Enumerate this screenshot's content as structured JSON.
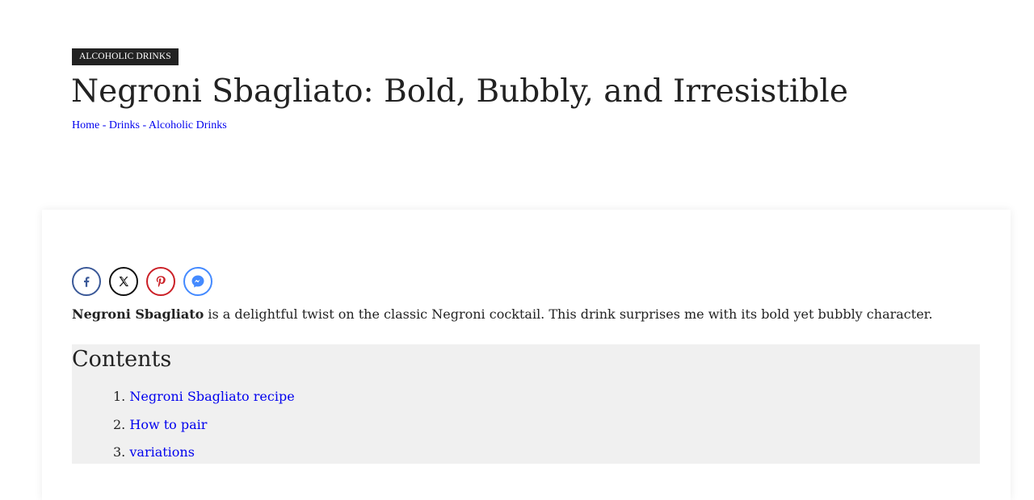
{
  "article": {
    "category": "ALCOHOLIC DRINKS",
    "title": "Negroni Sbagliato: Bold, Bubbly, and Irresistible",
    "breadcrumb": [
      {
        "label": "Home"
      },
      {
        "label": "Drinks"
      },
      {
        "label": "Alcoholic Drinks"
      }
    ],
    "breadcrumb_separator": " - "
  },
  "share": {
    "buttons": [
      {
        "name": "facebook",
        "icon": "facebook-icon",
        "color": "#3b5998"
      },
      {
        "name": "x",
        "icon": "x-icon",
        "color": "#111111"
      },
      {
        "name": "pinterest",
        "icon": "pinterest-icon",
        "color": "#cb2027"
      },
      {
        "name": "messenger",
        "icon": "messenger-icon",
        "color": "#448aff"
      }
    ]
  },
  "intro": {
    "bold": "Negroni Sbagliato",
    "text": " is a delightful twist on the classic Negroni cocktail. This drink surprises me with its bold yet bubbly character."
  },
  "toc": {
    "title": "Contents",
    "items": [
      {
        "number": "1.",
        "label": "Negroni Sbagliato recipe"
      },
      {
        "number": "2.",
        "label": "How to pair"
      },
      {
        "number": "3.",
        "label": "variations"
      }
    ]
  },
  "colors": {
    "link": "#0000ee",
    "badge_bg": "#222222",
    "toc_bg": "#f0f0f0"
  }
}
